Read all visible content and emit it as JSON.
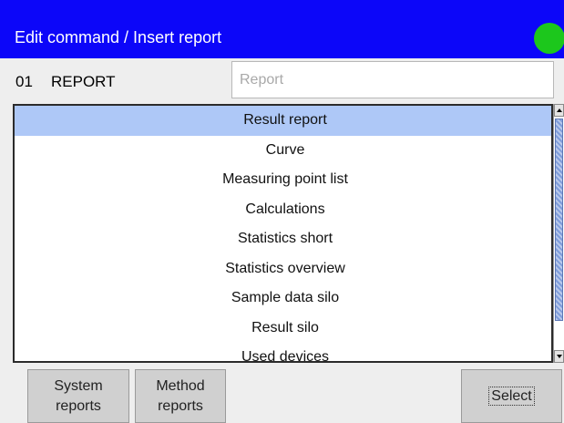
{
  "window": {
    "title": "Edit command / Insert report",
    "status_color": "#1cc71c"
  },
  "command": {
    "number": "01",
    "name": "REPORT",
    "field_placeholder": "Report"
  },
  "report_list": {
    "items": [
      "Result report",
      "Curve",
      "Measuring point list",
      "Calculations",
      "Statistics short",
      "Statistics overview",
      "Sample data silo",
      "Result silo",
      "Used devices"
    ],
    "selected_index": 0
  },
  "buttons": {
    "system_reports": [
      "System",
      "reports"
    ],
    "method_reports": [
      "Method",
      "reports"
    ],
    "select": "Select"
  }
}
